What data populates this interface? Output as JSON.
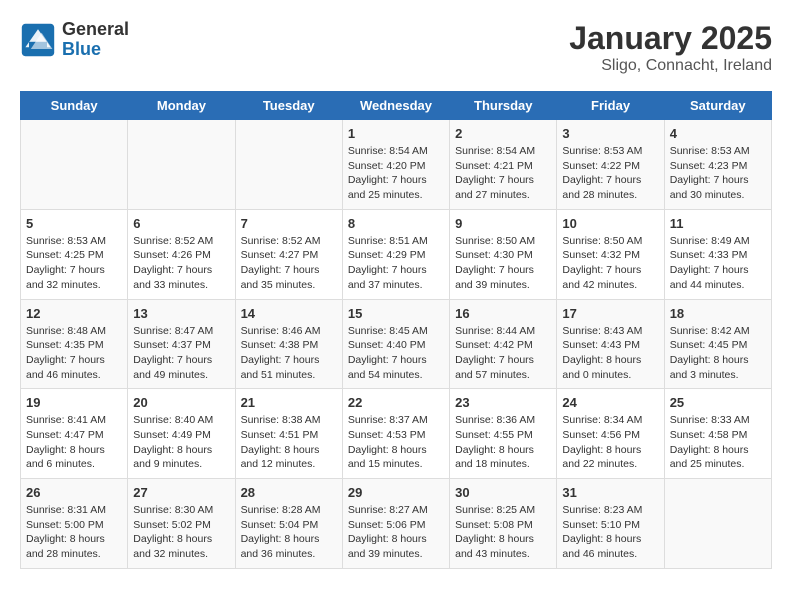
{
  "header": {
    "logo_line1": "General",
    "logo_line2": "Blue",
    "title": "January 2025",
    "subtitle": "Sligo, Connacht, Ireland"
  },
  "days_of_week": [
    "Sunday",
    "Monday",
    "Tuesday",
    "Wednesday",
    "Thursday",
    "Friday",
    "Saturday"
  ],
  "weeks": [
    [
      {
        "day": "",
        "sunrise": "",
        "sunset": "",
        "daylight": ""
      },
      {
        "day": "",
        "sunrise": "",
        "sunset": "",
        "daylight": ""
      },
      {
        "day": "",
        "sunrise": "",
        "sunset": "",
        "daylight": ""
      },
      {
        "day": "1",
        "sunrise": "Sunrise: 8:54 AM",
        "sunset": "Sunset: 4:20 PM",
        "daylight": "Daylight: 7 hours and 25 minutes."
      },
      {
        "day": "2",
        "sunrise": "Sunrise: 8:54 AM",
        "sunset": "Sunset: 4:21 PM",
        "daylight": "Daylight: 7 hours and 27 minutes."
      },
      {
        "day": "3",
        "sunrise": "Sunrise: 8:53 AM",
        "sunset": "Sunset: 4:22 PM",
        "daylight": "Daylight: 7 hours and 28 minutes."
      },
      {
        "day": "4",
        "sunrise": "Sunrise: 8:53 AM",
        "sunset": "Sunset: 4:23 PM",
        "daylight": "Daylight: 7 hours and 30 minutes."
      }
    ],
    [
      {
        "day": "5",
        "sunrise": "Sunrise: 8:53 AM",
        "sunset": "Sunset: 4:25 PM",
        "daylight": "Daylight: 7 hours and 32 minutes."
      },
      {
        "day": "6",
        "sunrise": "Sunrise: 8:52 AM",
        "sunset": "Sunset: 4:26 PM",
        "daylight": "Daylight: 7 hours and 33 minutes."
      },
      {
        "day": "7",
        "sunrise": "Sunrise: 8:52 AM",
        "sunset": "Sunset: 4:27 PM",
        "daylight": "Daylight: 7 hours and 35 minutes."
      },
      {
        "day": "8",
        "sunrise": "Sunrise: 8:51 AM",
        "sunset": "Sunset: 4:29 PM",
        "daylight": "Daylight: 7 hours and 37 minutes."
      },
      {
        "day": "9",
        "sunrise": "Sunrise: 8:50 AM",
        "sunset": "Sunset: 4:30 PM",
        "daylight": "Daylight: 7 hours and 39 minutes."
      },
      {
        "day": "10",
        "sunrise": "Sunrise: 8:50 AM",
        "sunset": "Sunset: 4:32 PM",
        "daylight": "Daylight: 7 hours and 42 minutes."
      },
      {
        "day": "11",
        "sunrise": "Sunrise: 8:49 AM",
        "sunset": "Sunset: 4:33 PM",
        "daylight": "Daylight: 7 hours and 44 minutes."
      }
    ],
    [
      {
        "day": "12",
        "sunrise": "Sunrise: 8:48 AM",
        "sunset": "Sunset: 4:35 PM",
        "daylight": "Daylight: 7 hours and 46 minutes."
      },
      {
        "day": "13",
        "sunrise": "Sunrise: 8:47 AM",
        "sunset": "Sunset: 4:37 PM",
        "daylight": "Daylight: 7 hours and 49 minutes."
      },
      {
        "day": "14",
        "sunrise": "Sunrise: 8:46 AM",
        "sunset": "Sunset: 4:38 PM",
        "daylight": "Daylight: 7 hours and 51 minutes."
      },
      {
        "day": "15",
        "sunrise": "Sunrise: 8:45 AM",
        "sunset": "Sunset: 4:40 PM",
        "daylight": "Daylight: 7 hours and 54 minutes."
      },
      {
        "day": "16",
        "sunrise": "Sunrise: 8:44 AM",
        "sunset": "Sunset: 4:42 PM",
        "daylight": "Daylight: 7 hours and 57 minutes."
      },
      {
        "day": "17",
        "sunrise": "Sunrise: 8:43 AM",
        "sunset": "Sunset: 4:43 PM",
        "daylight": "Daylight: 8 hours and 0 minutes."
      },
      {
        "day": "18",
        "sunrise": "Sunrise: 8:42 AM",
        "sunset": "Sunset: 4:45 PM",
        "daylight": "Daylight: 8 hours and 3 minutes."
      }
    ],
    [
      {
        "day": "19",
        "sunrise": "Sunrise: 8:41 AM",
        "sunset": "Sunset: 4:47 PM",
        "daylight": "Daylight: 8 hours and 6 minutes."
      },
      {
        "day": "20",
        "sunrise": "Sunrise: 8:40 AM",
        "sunset": "Sunset: 4:49 PM",
        "daylight": "Daylight: 8 hours and 9 minutes."
      },
      {
        "day": "21",
        "sunrise": "Sunrise: 8:38 AM",
        "sunset": "Sunset: 4:51 PM",
        "daylight": "Daylight: 8 hours and 12 minutes."
      },
      {
        "day": "22",
        "sunrise": "Sunrise: 8:37 AM",
        "sunset": "Sunset: 4:53 PM",
        "daylight": "Daylight: 8 hours and 15 minutes."
      },
      {
        "day": "23",
        "sunrise": "Sunrise: 8:36 AM",
        "sunset": "Sunset: 4:55 PM",
        "daylight": "Daylight: 8 hours and 18 minutes."
      },
      {
        "day": "24",
        "sunrise": "Sunrise: 8:34 AM",
        "sunset": "Sunset: 4:56 PM",
        "daylight": "Daylight: 8 hours and 22 minutes."
      },
      {
        "day": "25",
        "sunrise": "Sunrise: 8:33 AM",
        "sunset": "Sunset: 4:58 PM",
        "daylight": "Daylight: 8 hours and 25 minutes."
      }
    ],
    [
      {
        "day": "26",
        "sunrise": "Sunrise: 8:31 AM",
        "sunset": "Sunset: 5:00 PM",
        "daylight": "Daylight: 8 hours and 28 minutes."
      },
      {
        "day": "27",
        "sunrise": "Sunrise: 8:30 AM",
        "sunset": "Sunset: 5:02 PM",
        "daylight": "Daylight: 8 hours and 32 minutes."
      },
      {
        "day": "28",
        "sunrise": "Sunrise: 8:28 AM",
        "sunset": "Sunset: 5:04 PM",
        "daylight": "Daylight: 8 hours and 36 minutes."
      },
      {
        "day": "29",
        "sunrise": "Sunrise: 8:27 AM",
        "sunset": "Sunset: 5:06 PM",
        "daylight": "Daylight: 8 hours and 39 minutes."
      },
      {
        "day": "30",
        "sunrise": "Sunrise: 8:25 AM",
        "sunset": "Sunset: 5:08 PM",
        "daylight": "Daylight: 8 hours and 43 minutes."
      },
      {
        "day": "31",
        "sunrise": "Sunrise: 8:23 AM",
        "sunset": "Sunset: 5:10 PM",
        "daylight": "Daylight: 8 hours and 46 minutes."
      },
      {
        "day": "",
        "sunrise": "",
        "sunset": "",
        "daylight": ""
      }
    ]
  ]
}
